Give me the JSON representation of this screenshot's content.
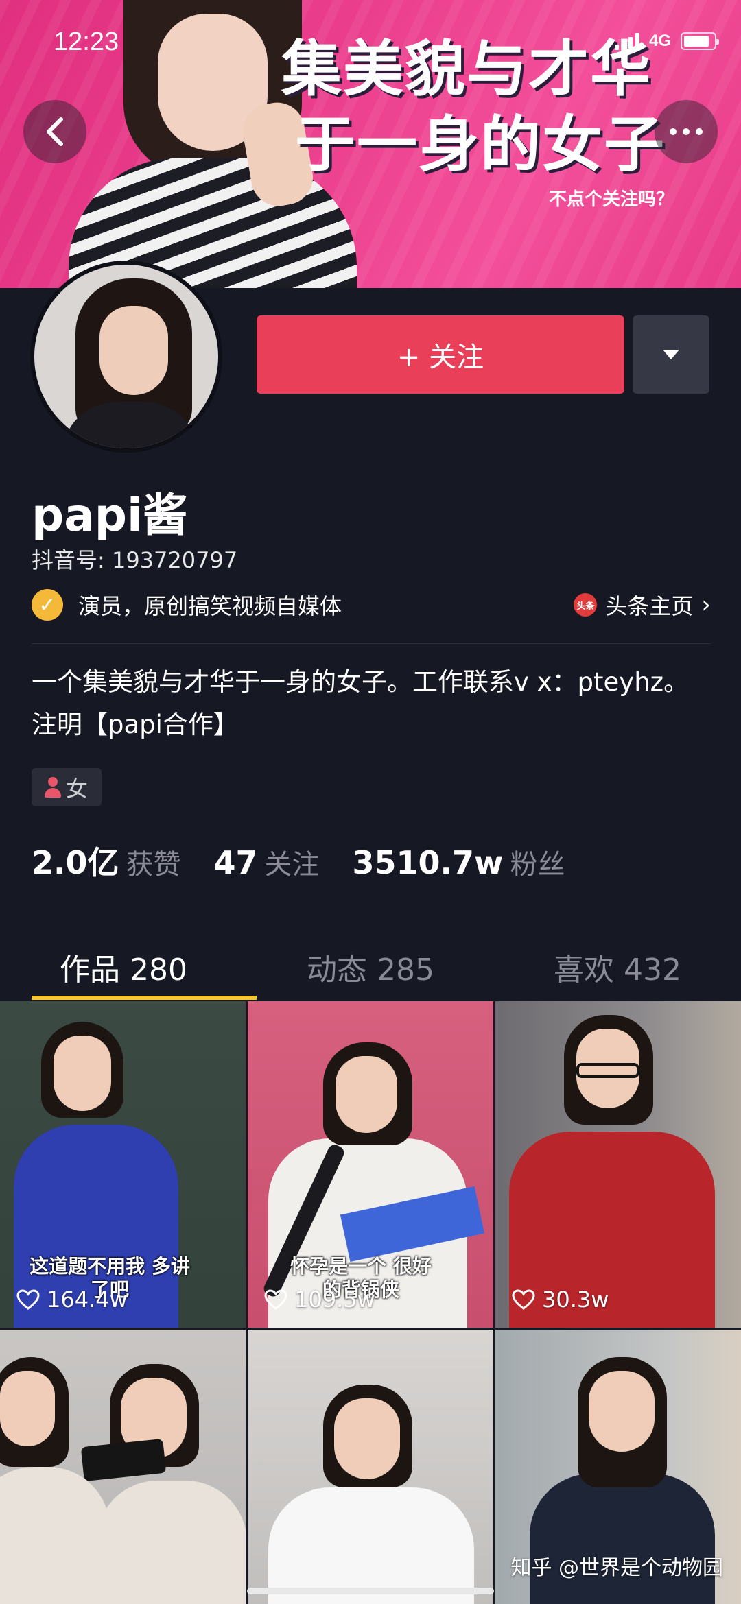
{
  "status_bar": {
    "time": "12:23",
    "network": "4G",
    "battery_level": 0.85
  },
  "banner": {
    "slogan_line1": "集美貌与才华",
    "slogan_line2": "于一身的女子",
    "slogan_small": "不点个关注吗？",
    "back_icon": "chevron-left-icon",
    "more_icon": "more-dots-icon"
  },
  "profile": {
    "follow_label": "+ 关注",
    "username": "papi酱",
    "douyin_id": "抖音号: 193720797",
    "verify_text": "演员，原创搞笑视频自媒体",
    "toutiao_label": "头条主页",
    "toutiao_icon_text": "头条",
    "bio": "一个集美貌与才华于一身的女子。工作联系v x：pteyhz。注明【papi合作】",
    "gender": "女"
  },
  "stats": [
    {
      "num": "2.0亿",
      "label": "获赞"
    },
    {
      "num": "47",
      "label": "关注"
    },
    {
      "num": "3510.7w",
      "label": "粉丝"
    }
  ],
  "tabs": [
    {
      "label": "作品 280",
      "active": true
    },
    {
      "label": "动态 285",
      "active": false
    },
    {
      "label": "喜欢 432",
      "active": false
    }
  ],
  "videos": [
    {
      "caption": "这道题不用我 多讲了吧",
      "likes": "164.4w"
    },
    {
      "caption": "怀孕是一个 很好的背锅侠",
      "likes": "109.5w"
    },
    {
      "caption": "",
      "likes": "30.3w"
    },
    {
      "caption": "",
      "likes": ""
    },
    {
      "caption": "",
      "likes": ""
    },
    {
      "caption": "",
      "likes": ""
    }
  ],
  "watermark": "知乎 @世界是个动物园",
  "colors": {
    "follow": "#ea3f58",
    "background": "#161823",
    "tab_underline": "#f5c732",
    "verify": "#f5b93a"
  }
}
